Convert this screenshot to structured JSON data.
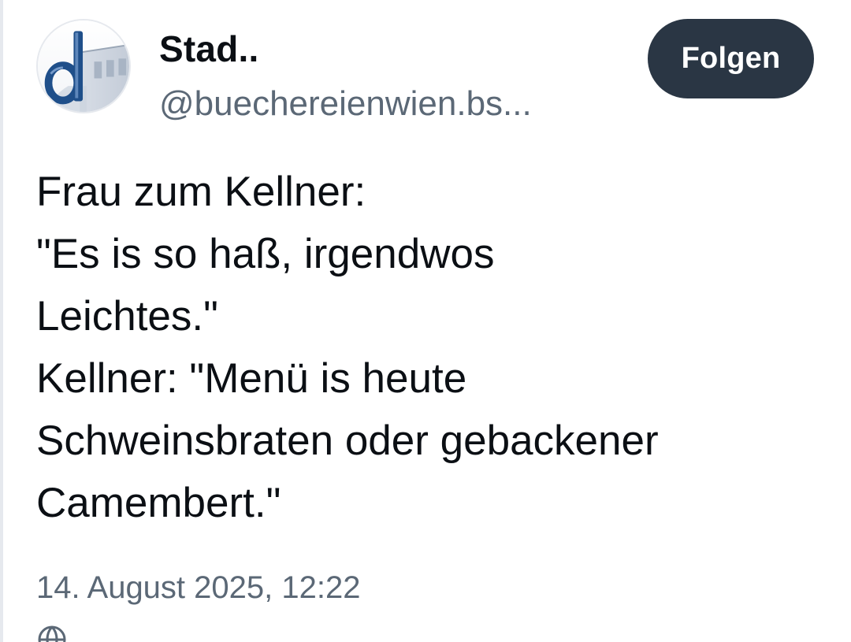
{
  "author": {
    "display_name": "Stad..",
    "handle": "@buechereienwien.bs...",
    "avatar_icon": "library-building-logo"
  },
  "follow_button": {
    "label": "Folgen",
    "background": "#2a3644",
    "text_color": "#ffffff"
  },
  "post": {
    "lines": [
      "Frau zum Kellner:",
      "\"Es is so haß, irgendwos",
      "Leichtes.\"",
      "Kellner: \"Menü is heute",
      "Schweinsbraten oder gebackener",
      "Camembert.\""
    ],
    "timestamp": "14. August 2025, 12:22"
  },
  "colors": {
    "text_primary": "#0b0f14",
    "text_secondary": "#5b6876"
  }
}
